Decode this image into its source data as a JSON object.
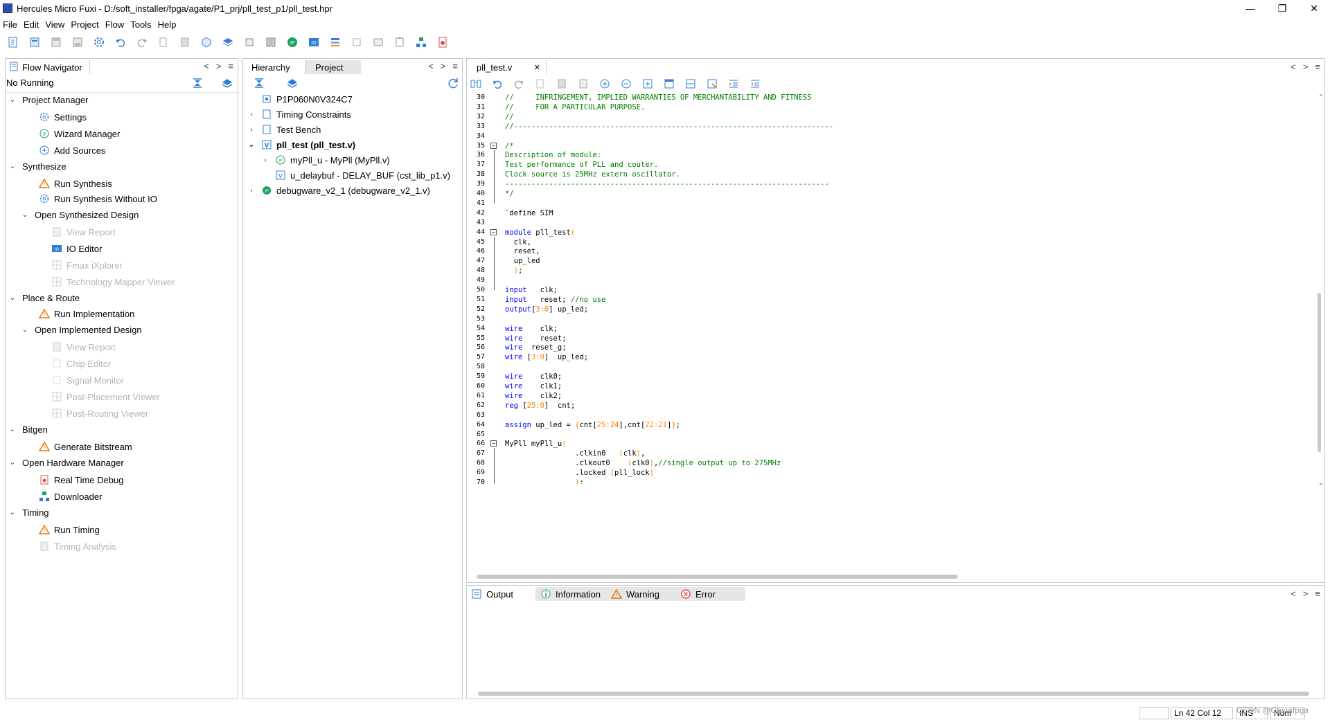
{
  "window": {
    "title": "Hercules Micro Fuxi - D:/soft_installer/fpga/agate/P1_prj/pll_test_p1/pll_test.hpr",
    "minimize": "—",
    "maximize": "❐",
    "close": "✕"
  },
  "menu": [
    "File",
    "Edit",
    "View",
    "Project",
    "Flow",
    "Tools",
    "Help"
  ],
  "flow_navigator": {
    "tab": "Flow Navigator",
    "status": "No Running",
    "items": [
      {
        "label": "Project Manager",
        "kind": "section"
      },
      {
        "label": "Settings",
        "kind": "item"
      },
      {
        "label": "Wizard Manager",
        "kind": "item"
      },
      {
        "label": "Add Sources",
        "kind": "item"
      },
      {
        "label": "Synthesize",
        "kind": "section"
      },
      {
        "label": "Run Synthesis",
        "kind": "item"
      },
      {
        "label": "Run Synthesis Without IO",
        "kind": "item"
      },
      {
        "label": "Open Synthesized Design",
        "kind": "subsection"
      },
      {
        "label": "View Report",
        "kind": "disabled"
      },
      {
        "label": "IO Editor",
        "kind": "item"
      },
      {
        "label": "Fmax iXplorer",
        "kind": "disabled"
      },
      {
        "label": "Technology Mapper Viewer",
        "kind": "disabled"
      },
      {
        "label": "Place & Route",
        "kind": "section"
      },
      {
        "label": "Run Implementation",
        "kind": "item"
      },
      {
        "label": "Open Implemented Design",
        "kind": "subsection"
      },
      {
        "label": "View Report",
        "kind": "disabled"
      },
      {
        "label": "Chip Editor",
        "kind": "disabled"
      },
      {
        "label": "Signal Monitor",
        "kind": "disabled"
      },
      {
        "label": "Post-Placement Viewer",
        "kind": "disabled"
      },
      {
        "label": "Post-Routing Viewer",
        "kind": "disabled"
      },
      {
        "label": "Bitgen",
        "kind": "section"
      },
      {
        "label": "Generate Bitstream",
        "kind": "item"
      },
      {
        "label": "Open Hardware Manager",
        "kind": "section"
      },
      {
        "label": "Real Time Debug",
        "kind": "item"
      },
      {
        "label": "Downloader",
        "kind": "item"
      },
      {
        "label": "Timing",
        "kind": "section"
      },
      {
        "label": "Run Timing",
        "kind": "item"
      },
      {
        "label": "Timing Analysis",
        "kind": "disabled"
      }
    ]
  },
  "hierarchy": {
    "tabs": [
      "Hierarchy",
      "Project"
    ],
    "items": [
      {
        "label": "P1P060N0V324C7"
      },
      {
        "label": "Timing Constraints"
      },
      {
        "label": "Test Bench"
      },
      {
        "label": "pll_test (pll_test.v)"
      },
      {
        "label": "myPll_u - MyPll (MyPll.v)"
      },
      {
        "label": "u_delaybuf - DELAY_BUF (cst_lib_p1.v)"
      },
      {
        "label": "debugware_v2_1 (debugware_v2_1.v)"
      }
    ]
  },
  "editor": {
    "tab": "pll_test.v",
    "tab_close": "✕",
    "lines": [
      {
        "n": "30",
        "t": "//     INFRINGEMENT, IMPLIED WARRANTIES OF MERCHANTABILITY AND FITNESS"
      },
      {
        "n": "31",
        "t": "//     FOR A PARTICULAR PURPOSE."
      },
      {
        "n": "32",
        "t": "//"
      },
      {
        "n": "33",
        "t": "//-------------------------------------------------------------------------"
      },
      {
        "n": "34",
        "t": ""
      },
      {
        "n": "35",
        "t": "/*"
      },
      {
        "n": "36",
        "t": "Description of module:"
      },
      {
        "n": "37",
        "t": "Test performance of PLL and couter."
      },
      {
        "n": "38",
        "t": "Clock source is 25MHz extern oscillator."
      },
      {
        "n": "39",
        "t": "--------------------------------------------------------------------------"
      },
      {
        "n": "40",
        "t": "*/"
      },
      {
        "n": "41",
        "t": ""
      },
      {
        "n": "42",
        "t": "`define SIM"
      },
      {
        "n": "43",
        "t": ""
      },
      {
        "n": "44",
        "t": "module pll_test("
      },
      {
        "n": "45",
        "t": "  clk,"
      },
      {
        "n": "46",
        "t": "  reset,"
      },
      {
        "n": "47",
        "t": "  up_led"
      },
      {
        "n": "48",
        "t": "  );"
      },
      {
        "n": "49",
        "t": ""
      },
      {
        "n": "50",
        "t": "input   clk;"
      },
      {
        "n": "51",
        "t": "input   reset; //no use"
      },
      {
        "n": "52",
        "t": "output[3:0] up_led;"
      },
      {
        "n": "53",
        "t": ""
      },
      {
        "n": "54",
        "t": "wire    clk;"
      },
      {
        "n": "55",
        "t": "wire    reset;"
      },
      {
        "n": "56",
        "t": "wire  reset_g;"
      },
      {
        "n": "57",
        "t": "wire [3:0]  up_led;"
      },
      {
        "n": "58",
        "t": ""
      },
      {
        "n": "59",
        "t": "wire    clk0;"
      },
      {
        "n": "60",
        "t": "wire    clk1;"
      },
      {
        "n": "61",
        "t": "wire    clk2;"
      },
      {
        "n": "62",
        "t": "reg [25:0]  cnt;"
      },
      {
        "n": "63",
        "t": ""
      },
      {
        "n": "64",
        "t": "assign up_led = {cnt[25:24],cnt[22:21]};"
      },
      {
        "n": "65",
        "t": ""
      },
      {
        "n": "66",
        "t": "MyPll myPll_u("
      },
      {
        "n": "67",
        "t": "                .clkin0   (clk),"
      },
      {
        "n": "68",
        "t": "                .clkout0    (clk0),//single output up to 275MHz"
      },
      {
        "n": "69",
        "t": "                .locked (pll_lock)"
      },
      {
        "n": "70",
        "t": "                );"
      }
    ]
  },
  "output_panel": {
    "tabs": [
      "Output",
      "Information",
      "Warning",
      "Error"
    ]
  },
  "statusbar": {
    "position": "Ln 42 Col 12",
    "mode": "INS",
    "num": "Num",
    "watermark": "CSDN @Chinafpga"
  },
  "colors": {
    "keyword": "#0000ff",
    "comment": "#008000",
    "number": "#ff8000",
    "warning": "#e8760a",
    "accent": "#2e7dd7"
  }
}
